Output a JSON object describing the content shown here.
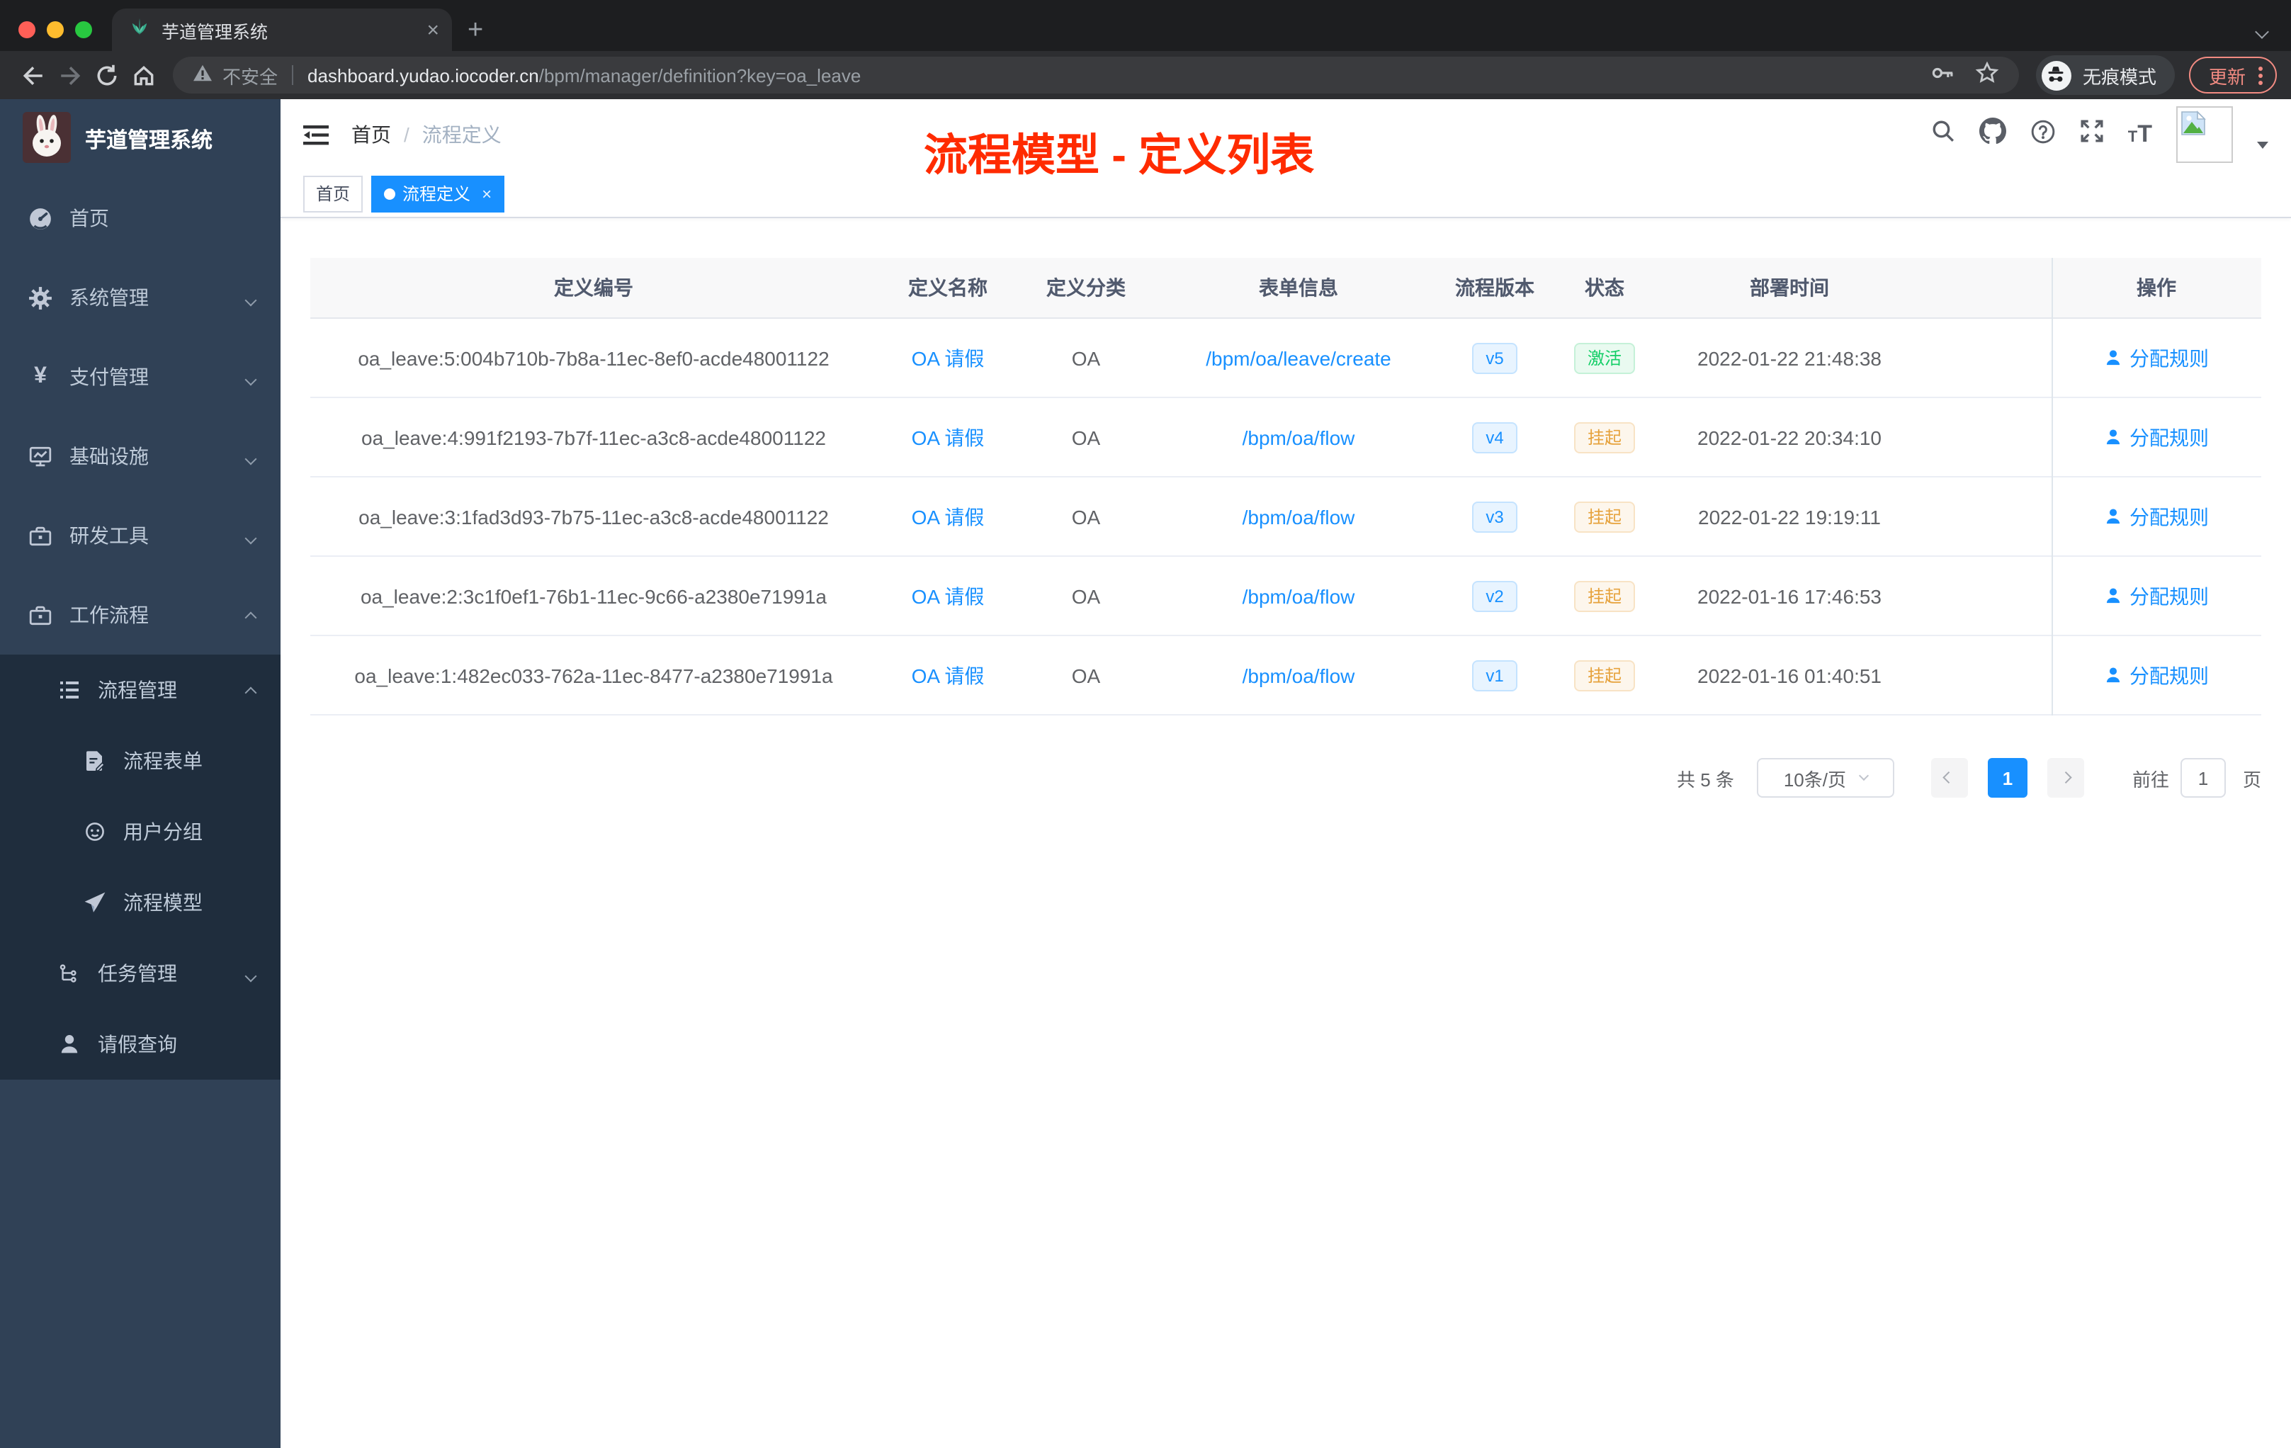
{
  "browser": {
    "tab_title": "芋道管理系统",
    "tab_close": "×",
    "new_tab_plus": "+",
    "security_label": "不安全",
    "url_domain": "dashboard.yudao.iocoder.cn",
    "url_path": "/bpm/manager/definition?key=oa_leave",
    "incognito_label": "无痕模式",
    "update_label": "更新"
  },
  "annotation": {
    "text": "流程模型 - 定义列表"
  },
  "sidebar": {
    "logo_title": "芋道管理系统",
    "items": [
      {
        "label": "首页",
        "icon": "dashboard-icon"
      },
      {
        "label": "系统管理",
        "icon": "gear-icon"
      },
      {
        "label": "支付管理",
        "icon": "yen-icon"
      },
      {
        "label": "基础设施",
        "icon": "monitor-icon"
      },
      {
        "label": "研发工具",
        "icon": "toolbox-icon"
      },
      {
        "label": "工作流程",
        "icon": "toolbox-icon"
      }
    ],
    "submenu": [
      {
        "label": "流程管理",
        "icon": "list-icon"
      },
      {
        "label": "流程表单",
        "icon": "form-icon"
      },
      {
        "label": "用户分组",
        "icon": "user-group-icon"
      },
      {
        "label": "流程模型",
        "icon": "paper-plane-icon"
      },
      {
        "label": "任务管理",
        "icon": "tree-icon"
      },
      {
        "label": "请假查询",
        "icon": "person-icon"
      }
    ]
  },
  "navbar": {
    "breadcrumb_home": "首页",
    "breadcrumb_sep": "/",
    "breadcrumb_current": "流程定义"
  },
  "tags": {
    "home": "首页",
    "active": "流程定义",
    "close": "×"
  },
  "table": {
    "columns": [
      "定义编号",
      "定义名称",
      "定义分类",
      "表单信息",
      "流程版本",
      "状态",
      "部署时间",
      "操作"
    ],
    "action_label": "分配规则",
    "rows": [
      {
        "id": "oa_leave:5:004b710b-7b8a-11ec-8ef0-acde48001122",
        "name": "OA 请假",
        "category": "OA",
        "form": "/bpm/oa/leave/create",
        "version": "v5",
        "status": "激活",
        "time": "2022-01-22 21:48:38"
      },
      {
        "id": "oa_leave:4:991f2193-7b7f-11ec-a3c8-acde48001122",
        "name": "OA 请假",
        "category": "OA",
        "form": "/bpm/oa/flow",
        "version": "v4",
        "status": "挂起",
        "time": "2022-01-22 20:34:10"
      },
      {
        "id": "oa_leave:3:1fad3d93-7b75-11ec-a3c8-acde48001122",
        "name": "OA 请假",
        "category": "OA",
        "form": "/bpm/oa/flow",
        "version": "v3",
        "status": "挂起",
        "time": "2022-01-22 19:19:11"
      },
      {
        "id": "oa_leave:2:3c1f0ef1-76b1-11ec-9c66-a2380e71991a",
        "name": "OA 请假",
        "category": "OA",
        "form": "/bpm/oa/flow",
        "version": "v2",
        "status": "挂起",
        "time": "2022-01-16 17:46:53"
      },
      {
        "id": "oa_leave:1:482ec033-762a-11ec-8477-a2380e71991a",
        "name": "OA 请假",
        "category": "OA",
        "form": "/bpm/oa/flow",
        "version": "v1",
        "status": "挂起",
        "time": "2022-01-16 01:40:51"
      }
    ]
  },
  "pagination": {
    "total": "共 5 条",
    "page_size": "10条/页",
    "current": "1",
    "goto_label": "前往",
    "goto_value": "1",
    "unit": "页"
  },
  "colors": {
    "primary": "#1890ff",
    "success": "#13ce66",
    "warning": "#e6a23c",
    "annotation_red": "#ff2b00",
    "sidebar_bg": "#304156",
    "submenu_bg": "#1f2d3d"
  }
}
